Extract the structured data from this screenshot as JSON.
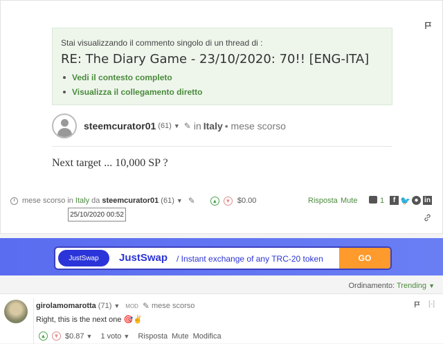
{
  "notice": {
    "lead": "Stai visualizzando il commento singolo di un thread di :",
    "title": "RE: The Diary Game - 23/10/2020: 70!! [ENG-ITA]",
    "links": [
      "Vedi il contesto completo",
      "Visualizza il collegamento diretto"
    ]
  },
  "author": {
    "name": "steemcurator01",
    "rep": "(61)",
    "in_label": "in",
    "category": "Italy",
    "ago": "• mese scorso"
  },
  "body": "Next target ... 10,000 SP ?",
  "footer": {
    "ago": "mese scorso",
    "in_label": "in",
    "category": "Italy",
    "by_label": "da",
    "author": "steemcurator01",
    "rep": "(61)",
    "payout": "$0.00",
    "reply": "Risposta",
    "mute": "Mute",
    "comments": "1",
    "timestamp": "25/10/2020 00:52"
  },
  "banner": {
    "pill": "JustSwap",
    "title": "JustSwap",
    "subtitle": "/ Instant exchange of any TRC-20 token",
    "cta": "GO"
  },
  "sort": {
    "label": "Ordinamento:",
    "value": "Trending"
  },
  "comment": {
    "author": "girolamomarotta",
    "rep": "(71)",
    "badge": "MOD",
    "ago": "mese scorso",
    "text": "Right, this is the next one 🎯✌",
    "collapse": "[-]",
    "payout": "$0.87",
    "votes": "1 voto",
    "reply": "Risposta",
    "mute": "Mute",
    "edit": "Modifica"
  },
  "colors": {
    "accent": "#4b8a3c",
    "banner": "#5a6cf0",
    "cta": "#ff9a2c"
  }
}
